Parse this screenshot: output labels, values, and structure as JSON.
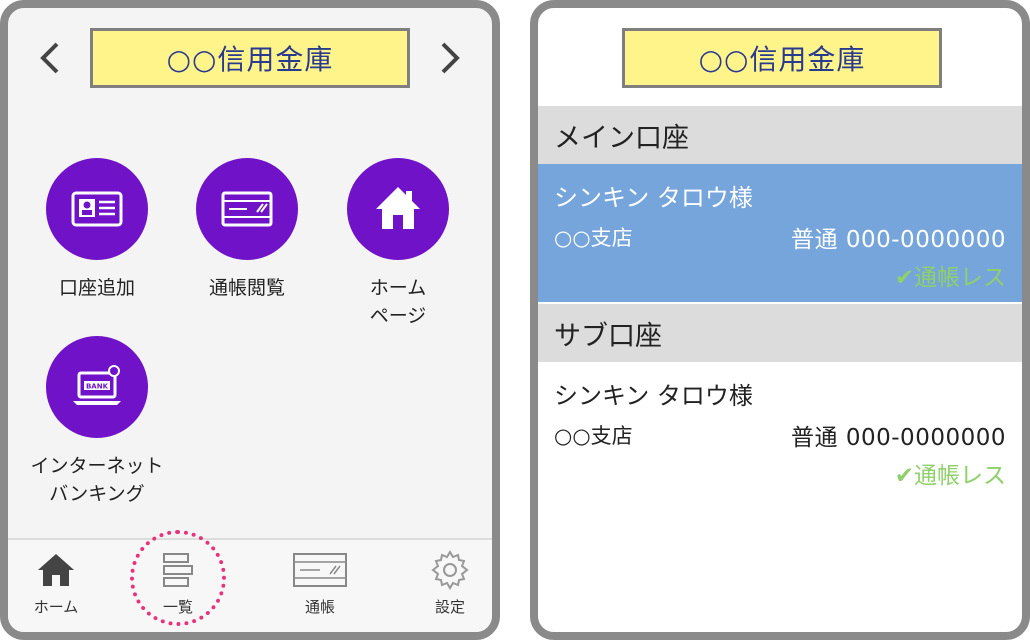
{
  "colors": {
    "accent_purple": "#6f12c8",
    "title_bg": "#fff48a",
    "title_text": "#2a3a8f",
    "selected_row": "#76a5db",
    "passbook_green": "#8ed06a",
    "highlight_dashed": "#e8337a"
  },
  "left_screen": {
    "title": "○○信用金庫",
    "prev_icon": "chevron-left-icon",
    "next_icon": "chevron-right-icon",
    "menu": [
      {
        "label": "口座追加",
        "icon": "id-card-icon"
      },
      {
        "label": "通帳閲覧",
        "icon": "passbook-card-icon"
      },
      {
        "label": "ホーム\nページ",
        "icon": "home-icon"
      },
      {
        "label": "インターネット\nバンキング",
        "icon": "laptop-bank-icon"
      }
    ],
    "nav": [
      {
        "label": "ホーム",
        "icon": "home-icon"
      },
      {
        "label": "一覧",
        "icon": "list-icon"
      },
      {
        "label": "通帳",
        "icon": "passbook-icon"
      },
      {
        "label": "設定",
        "icon": "gear-icon"
      }
    ]
  },
  "right_screen": {
    "title": "○○信用金庫",
    "main_section": "メイン口座",
    "sub_section": "サブ口座",
    "accounts": [
      {
        "name": "シンキン タロウ様",
        "branch": "○○支店",
        "number": "普通 000-0000000",
        "status": "✔通帳レス"
      },
      {
        "name": "シンキン タロウ様",
        "branch": "○○支店",
        "number": "普通 000-0000000",
        "status": "✔通帳レス"
      }
    ]
  }
}
